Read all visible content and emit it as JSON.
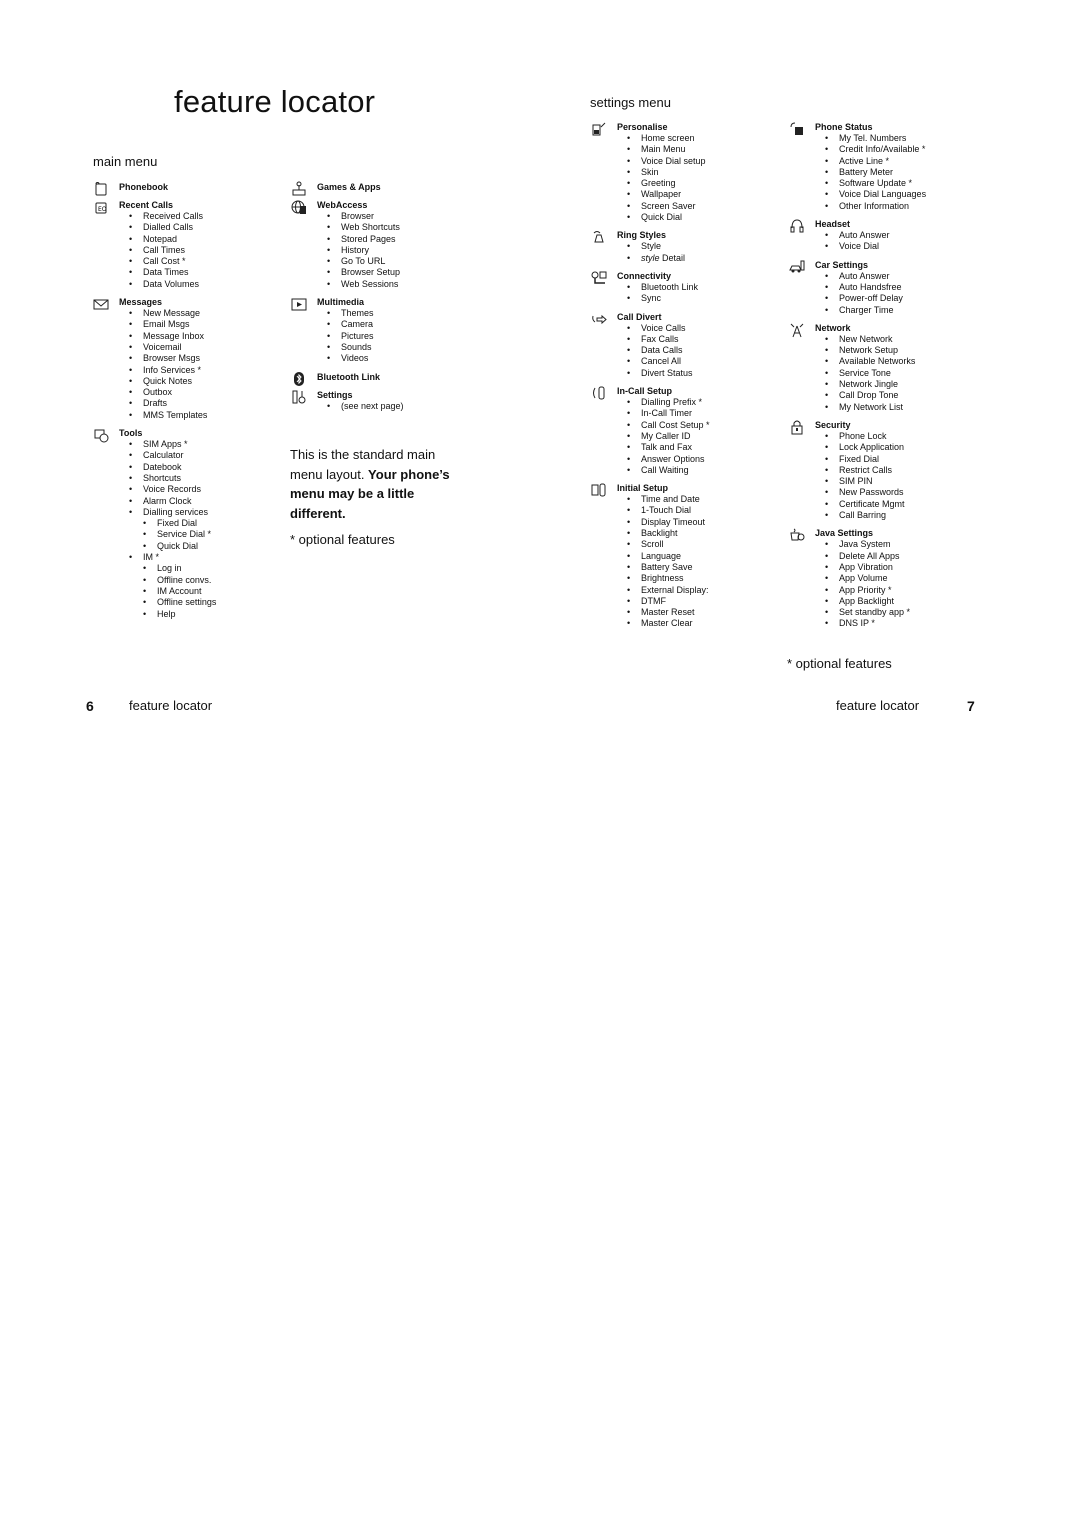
{
  "page_title": "feature locator",
  "main_menu": {
    "heading": "main menu",
    "columns": [
      [
        {
          "name": "Phonebook",
          "icon": "phonebook-icon",
          "items": []
        },
        {
          "name": "Recent Calls",
          "icon": "recent-calls-icon",
          "items": [
            {
              "label": "Received Calls"
            },
            {
              "label": "Dialled Calls"
            },
            {
              "label": "Notepad"
            },
            {
              "label": "Call Times"
            },
            {
              "label": "Call Cost *"
            },
            {
              "label": "Data Times"
            },
            {
              "label": "Data Volumes"
            }
          ]
        },
        {
          "name": "Messages",
          "icon": "envelope-icon",
          "items": [
            {
              "label": "New Message"
            },
            {
              "label": "Email Msgs"
            },
            {
              "label": "Message Inbox"
            },
            {
              "label": "Voicemail"
            },
            {
              "label": "Browser Msgs"
            },
            {
              "label": "Info Services *"
            },
            {
              "label": "Quick Notes"
            },
            {
              "label": "Outbox"
            },
            {
              "label": "Drafts"
            },
            {
              "label": "MMS Templates"
            }
          ]
        },
        {
          "name": "Tools",
          "icon": "tools-icon",
          "items": [
            {
              "label": "SIM Apps *"
            },
            {
              "label": "Calculator"
            },
            {
              "label": "Datebook"
            },
            {
              "label": "Shortcuts"
            },
            {
              "label": "Voice Records"
            },
            {
              "label": "Alarm Clock"
            },
            {
              "label": "Dialling services"
            },
            {
              "label": "Fixed Dial",
              "sub": true
            },
            {
              "label": "Service Dial *",
              "sub": true
            },
            {
              "label": "Quick Dial",
              "sub": true
            },
            {
              "label": "IM *"
            },
            {
              "label": "Log in",
              "sub": true
            },
            {
              "label": "Offline convs.",
              "sub": true
            },
            {
              "label": "IM Account",
              "sub": true
            },
            {
              "label": "Offline settings",
              "sub": true
            },
            {
              "label": "Help",
              "sub": true
            }
          ]
        }
      ],
      [
        {
          "name": "Games & Apps",
          "icon": "joystick-icon",
          "items": []
        },
        {
          "name": "WebAccess",
          "icon": "globe-icon",
          "items": [
            {
              "label": "Browser"
            },
            {
              "label": "Web Shortcuts"
            },
            {
              "label": "Stored Pages"
            },
            {
              "label": "History"
            },
            {
              "label": "Go To URL"
            },
            {
              "label": "Browser Setup"
            },
            {
              "label": "Web Sessions"
            }
          ]
        },
        {
          "name": "Multimedia",
          "icon": "film-icon",
          "items": [
            {
              "label": "Themes"
            },
            {
              "label": "Camera"
            },
            {
              "label": "Pictures"
            },
            {
              "label": "Sounds"
            },
            {
              "label": "Videos"
            }
          ]
        },
        {
          "name": "Bluetooth Link",
          "icon": "bluetooth-icon",
          "items": []
        },
        {
          "name": "Settings",
          "icon": "settings-icon",
          "items": [
            {
              "label": "(see next page)"
            }
          ]
        }
      ]
    ],
    "note_plain": "This is the standard main menu layout. ",
    "note_bold": "Your phone’s menu may be a little different.",
    "optional": "* optional features"
  },
  "settings_menu": {
    "heading": "settings menu",
    "columns": [
      [
        {
          "name": "Personalise",
          "icon": "personalise-icon",
          "items": [
            {
              "label": "Home screen"
            },
            {
              "label": "Main Menu"
            },
            {
              "label": "Voice Dial setup"
            },
            {
              "label": "Skin"
            },
            {
              "label": "Greeting"
            },
            {
              "label": "Wallpaper"
            },
            {
              "label": "Screen Saver"
            },
            {
              "label": "Quick Dial"
            }
          ]
        },
        {
          "name": "Ring Styles",
          "icon": "bell-icon",
          "items": [
            {
              "label": "Style"
            },
            {
              "label": "Detail",
              "italic_prefix": "style"
            }
          ]
        },
        {
          "name": "Connectivity",
          "icon": "connectivity-icon",
          "items": [
            {
              "label": "Bluetooth Link"
            },
            {
              "label": "Sync"
            }
          ]
        },
        {
          "name": "Call Divert",
          "icon": "call-divert-icon",
          "items": [
            {
              "label": "Voice Calls"
            },
            {
              "label": "Fax Calls"
            },
            {
              "label": "Data Calls"
            },
            {
              "label": "Cancel All"
            },
            {
              "label": "Divert Status"
            }
          ]
        },
        {
          "name": "In-Call Setup",
          "icon": "in-call-setup-icon",
          "items": [
            {
              "label": "Dialling Prefix *"
            },
            {
              "label": "In-Call Timer"
            },
            {
              "label": "Call Cost Setup *"
            },
            {
              "label": "My Caller ID"
            },
            {
              "label": "Talk and Fax"
            },
            {
              "label": "Answer Options"
            },
            {
              "label": "Call Waiting"
            }
          ]
        },
        {
          "name": "Initial Setup",
          "icon": "initial-setup-icon",
          "items": [
            {
              "label": "Time and Date"
            },
            {
              "label": "1-Touch Dial"
            },
            {
              "label": "Display Timeout"
            },
            {
              "label": "Backlight"
            },
            {
              "label": "Scroll"
            },
            {
              "label": "Language"
            },
            {
              "label": "Battery Save"
            },
            {
              "label": "Brightness"
            },
            {
              "label": "External Display:"
            },
            {
              "label": "DTMF"
            },
            {
              "label": "Master Reset"
            },
            {
              "label": "Master Clear"
            }
          ]
        }
      ],
      [
        {
          "name": "Phone Status",
          "icon": "phone-status-icon",
          "items": [
            {
              "label": "My Tel. Numbers"
            },
            {
              "label": "Credit Info/Available *"
            },
            {
              "label": "Active Line *"
            },
            {
              "label": "Battery Meter"
            },
            {
              "label": "Software Update *"
            },
            {
              "label": "Voice Dial Languages"
            },
            {
              "label": "Other Information"
            }
          ]
        },
        {
          "name": "Headset",
          "icon": "headset-icon",
          "items": [
            {
              "label": "Auto Answer"
            },
            {
              "label": "Voice Dial"
            }
          ]
        },
        {
          "name": "Car Settings",
          "icon": "car-icon",
          "items": [
            {
              "label": "Auto Answer"
            },
            {
              "label": "Auto Handsfree"
            },
            {
              "label": "Power-off Delay"
            },
            {
              "label": "Charger Time"
            }
          ]
        },
        {
          "name": "Network",
          "icon": "antenna-icon",
          "items": [
            {
              "label": "New Network"
            },
            {
              "label": "Network Setup"
            },
            {
              "label": "Available Networks"
            },
            {
              "label": "Service Tone"
            },
            {
              "label": "Network Jingle"
            },
            {
              "label": "Call Drop Tone"
            },
            {
              "label": "My Network List"
            }
          ]
        },
        {
          "name": "Security",
          "icon": "lock-icon",
          "items": [
            {
              "label": "Phone Lock"
            },
            {
              "label": "Lock Application"
            },
            {
              "label": "Fixed Dial"
            },
            {
              "label": "Restrict Calls"
            },
            {
              "label": "SIM PIN"
            },
            {
              "label": "New Passwords"
            },
            {
              "label": "Certificate Mgmt"
            },
            {
              "label": "Call Barring"
            }
          ]
        },
        {
          "name": "Java Settings",
          "icon": "java-cup-icon",
          "items": [
            {
              "label": "Java System"
            },
            {
              "label": "Delete All Apps"
            },
            {
              "label": "App Vibration"
            },
            {
              "label": "App Volume"
            },
            {
              "label": "App Priority *"
            },
            {
              "label": "App Backlight"
            },
            {
              "label": "Set standby app *"
            },
            {
              "label": "DNS IP *"
            }
          ]
        }
      ]
    ],
    "optional": "* optional features"
  },
  "footer": {
    "left_page_number": "6",
    "left_label": "feature locator",
    "right_label": "feature locator",
    "right_page_number": "7"
  }
}
